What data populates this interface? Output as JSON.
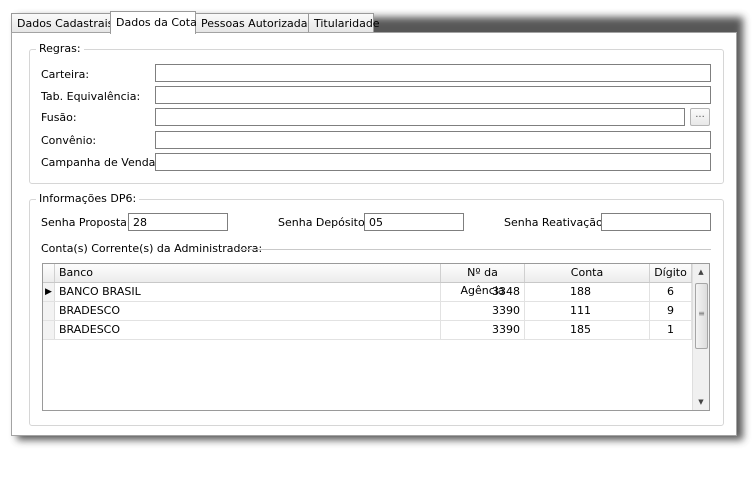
{
  "tabs": [
    {
      "label": "Dados Cadastrais"
    },
    {
      "label": "Dados da Cota"
    },
    {
      "label": "Pessoas Autorizadas"
    },
    {
      "label": "Titularidade"
    }
  ],
  "regras": {
    "title": "Regras:",
    "carteira_label": "Carteira:",
    "carteira_value": "",
    "tab_equivalencia_label": "Tab. Equivalência:",
    "tab_equivalencia_value": "",
    "fusao_label": "Fusão:",
    "fusao_value": "",
    "fusao_button": "...",
    "convenio_label": "Convênio:",
    "convenio_value": "",
    "campanha_label": "Campanha de Venda:",
    "campanha_value": ""
  },
  "dp6": {
    "title": "Informações DP6:",
    "senha_proposta_label": "Senha Proposta:",
    "senha_proposta_value": "28",
    "senha_deposito_label": "Senha Depósito:",
    "senha_deposito_value": "05",
    "senha_reativacao_label": "Senha Reativação:",
    "senha_reativacao_value": "",
    "contas_title": "Conta(s) Corrente(s) da Administradora:"
  },
  "grid": {
    "columns": [
      "Banco",
      "Nº da Agência",
      "Conta",
      "Dígito"
    ],
    "rows": [
      {
        "banco": "BANCO BRASIL",
        "agencia": "3348",
        "conta": "188",
        "digito": "6"
      },
      {
        "banco": "BRADESCO",
        "agencia": "3390",
        "conta": "111",
        "digito": "9"
      },
      {
        "banco": "BRADESCO",
        "agencia": "3390",
        "conta": "185",
        "digito": "1"
      }
    ],
    "current_row_indicator": "▶"
  }
}
